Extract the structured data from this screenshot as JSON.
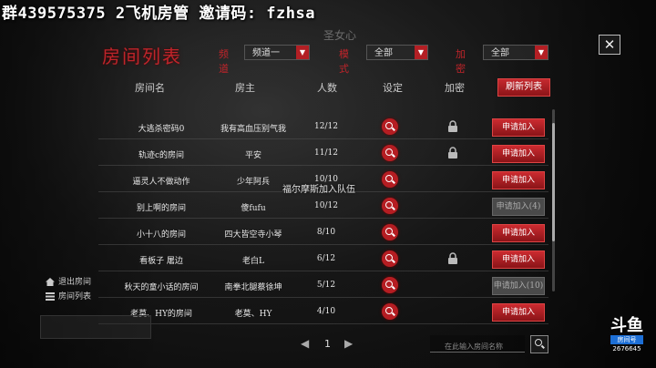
{
  "stream_overlay": "群439575375  2飞机房管 邀请码: fzhsa",
  "background_sign": "圣女心",
  "panel": {
    "title": "房间列表",
    "close_symbol": "✕"
  },
  "filters": [
    {
      "label": "频道",
      "value": "频道一"
    },
    {
      "label": "模式",
      "value": "全部"
    },
    {
      "label": "加密",
      "value": "全部"
    }
  ],
  "table": {
    "headers": [
      "房间名",
      "房主",
      "人数",
      "设定",
      "加密"
    ],
    "refresh_label": "刷新列表",
    "rows": [
      {
        "name": "大逃杀密码0",
        "owner": "我有高血压别气我",
        "count": "12/12",
        "locked": true,
        "join": "申请加入",
        "join_enabled": true
      },
      {
        "name": "轨迹c的房间",
        "owner": "平安",
        "count": "11/12",
        "locked": true,
        "join": "申请加入",
        "join_enabled": true
      },
      {
        "name": "逼灵人不做动作",
        "owner": "少年阿兵",
        "count": "10/10",
        "locked": false,
        "join": "申请加入",
        "join_enabled": true
      },
      {
        "name": "别上啊的房间",
        "owner": "傻fufu",
        "count": "10/12",
        "locked": false,
        "join": "申请加入(4)",
        "join_enabled": false
      },
      {
        "name": "小十八的房间",
        "owner": "四大皆空寺小琴",
        "count": "8/10",
        "locked": false,
        "join": "申请加入",
        "join_enabled": true
      },
      {
        "name": "看板子 屠边",
        "owner": "老白L",
        "count": "6/12",
        "locked": true,
        "join": "申请加入",
        "join_enabled": true
      },
      {
        "name": "秋天的童小话的房间",
        "owner": "南拳北腿蔡徐坤",
        "count": "5/12",
        "locked": false,
        "join": "申请加入(10)",
        "join_enabled": false
      },
      {
        "name": "老莫、HY的房间",
        "owner": "老莫、HY",
        "count": "4/10",
        "locked": false,
        "join": "申请加入",
        "join_enabled": true
      }
    ]
  },
  "toast": "福尔摩斯加入队伍",
  "side_menu": [
    {
      "icon": "home-icon",
      "label": "退出房间"
    },
    {
      "icon": "list-icon",
      "label": "房间列表"
    }
  ],
  "pager": {
    "prev": "◀",
    "page": "1",
    "next": "▶"
  },
  "search": {
    "placeholder": "在此输入房间名称"
  },
  "watermark": {
    "logo": "斗鱼",
    "tag": "房间号",
    "room_id": "2676645"
  },
  "colors": {
    "accent": "#c0242a",
    "panel_bg": "#1b1b1b"
  }
}
